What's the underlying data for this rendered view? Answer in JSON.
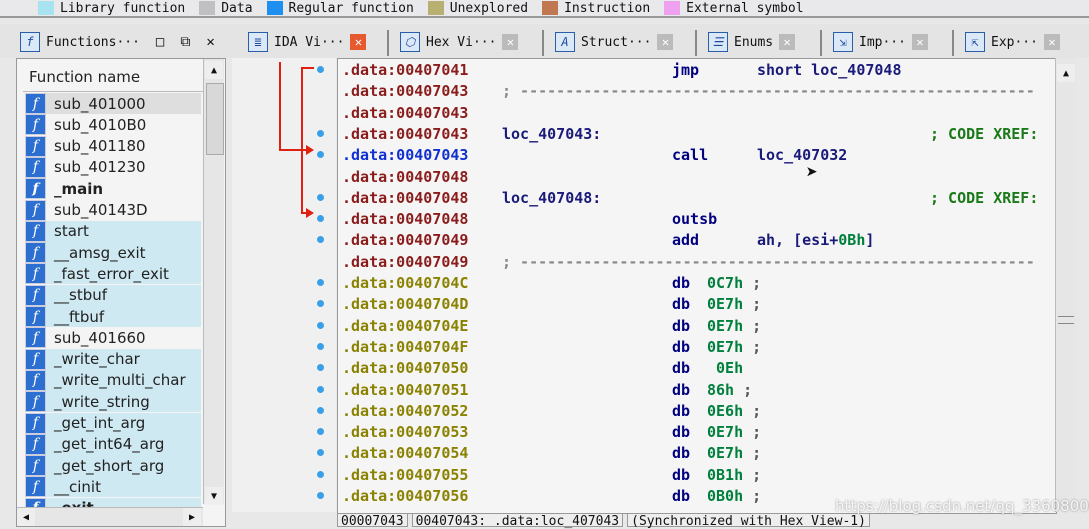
{
  "legend": [
    {
      "label": "Library function",
      "color": "#a8e4f0"
    },
    {
      "label": "Data",
      "color": "#c0c0c0"
    },
    {
      "label": "Regular function",
      "color": "#1e8ef0"
    },
    {
      "label": "Unexplored",
      "color": "#b8b070"
    },
    {
      "label": "Instruction",
      "color": "#c07850"
    },
    {
      "label": "External symbol",
      "color": "#f0a0f0"
    }
  ],
  "tabs": [
    {
      "label": "Functions···",
      "icon": "function-icon"
    },
    {
      "label": "IDA Vi···",
      "icon": "ida-view-icon",
      "active": true
    },
    {
      "label": "Hex Vi···",
      "icon": "hex-view-icon"
    },
    {
      "label": "Struct···",
      "icon": "structures-icon"
    },
    {
      "label": "Enums",
      "icon": "enums-icon"
    },
    {
      "label": "Imp···",
      "icon": "imports-icon"
    },
    {
      "label": "Exp···",
      "icon": "exports-icon"
    }
  ],
  "functions": {
    "header": "Function name",
    "items": [
      {
        "name": "sub_401000",
        "kind": "regular",
        "selected": true
      },
      {
        "name": "sub_4010B0",
        "kind": "regular"
      },
      {
        "name": "sub_401180",
        "kind": "regular"
      },
      {
        "name": "sub_401230",
        "kind": "regular"
      },
      {
        "name": "_main",
        "kind": "regular",
        "bold": true
      },
      {
        "name": "sub_40143D",
        "kind": "regular"
      },
      {
        "name": "start",
        "kind": "library"
      },
      {
        "name": "__amsg_exit",
        "kind": "library"
      },
      {
        "name": "_fast_error_exit",
        "kind": "library"
      },
      {
        "name": "__stbuf",
        "kind": "library"
      },
      {
        "name": "__ftbuf",
        "kind": "library"
      },
      {
        "name": "sub_401660",
        "kind": "regular"
      },
      {
        "name": "_write_char",
        "kind": "library"
      },
      {
        "name": "_write_multi_char",
        "kind": "library"
      },
      {
        "name": "_write_string",
        "kind": "library"
      },
      {
        "name": "_get_int_arg",
        "kind": "library"
      },
      {
        "name": "_get_int64_arg",
        "kind": "library"
      },
      {
        "name": "_get_short_arg",
        "kind": "library"
      },
      {
        "name": "__cinit",
        "kind": "library"
      },
      {
        "name": "_exit",
        "kind": "library",
        "bold": true
      }
    ]
  },
  "code": [
    {
      "addr": ".data:00407041",
      "mn": "jmp",
      "op": "short loc_407048",
      "style": "explored"
    },
    {
      "addr": ".data:00407043",
      "sep": true,
      "style": "explored"
    },
    {
      "addr": ".data:00407043",
      "style": "explored"
    },
    {
      "addr": ".data:00407043",
      "label": "loc_407043:",
      "comment": "; CODE XREF:",
      "style": "explored"
    },
    {
      "addr": ".data:00407043",
      "mn": "call",
      "op": "loc_407032",
      "style": "current"
    },
    {
      "addr": ".data:00407048",
      "style": "explored"
    },
    {
      "addr": ".data:00407048",
      "label": "loc_407048:",
      "comment": "; CODE XREF:",
      "style": "explored"
    },
    {
      "addr": ".data:00407048",
      "mn": "outsb",
      "style": "explored"
    },
    {
      "addr": ".data:00407049",
      "mn": "add",
      "op": "ah, [esi+",
      "num": "0Bh",
      "op2": "]",
      "style": "explored"
    },
    {
      "addr": ".data:00407049",
      "sep": true,
      "style": "explored"
    },
    {
      "addr": ".data:0040704C",
      "mn": "db",
      "num": "0C7h",
      "semi": ";",
      "style": "unexplored"
    },
    {
      "addr": ".data:0040704D",
      "mn": "db",
      "num": "0E7h",
      "semi": ";",
      "style": "unexplored"
    },
    {
      "addr": ".data:0040704E",
      "mn": "db",
      "num": "0E7h",
      "semi": ";",
      "style": "unexplored"
    },
    {
      "addr": ".data:0040704F",
      "mn": "db",
      "num": "0E7h",
      "semi": ";",
      "style": "unexplored"
    },
    {
      "addr": ".data:00407050",
      "mn": "db",
      "num": " 0Eh",
      "style": "unexplored"
    },
    {
      "addr": ".data:00407051",
      "mn": "db",
      "num": "86h",
      "semi": ";",
      "style": "unexplored"
    },
    {
      "addr": ".data:00407052",
      "mn": "db",
      "num": "0E6h",
      "semi": ";",
      "style": "unexplored"
    },
    {
      "addr": ".data:00407053",
      "mn": "db",
      "num": "0E7h",
      "semi": ";",
      "style": "unexplored"
    },
    {
      "addr": ".data:00407054",
      "mn": "db",
      "num": "0E7h",
      "semi": ";",
      "style": "unexplored"
    },
    {
      "addr": ".data:00407055",
      "mn": "db",
      "num": "0B1h",
      "semi": ";",
      "style": "unexplored"
    },
    {
      "addr": ".data:00407056",
      "mn": "db",
      "num": "0B0h",
      "semi": ";",
      "style": "unexplored"
    }
  ],
  "separator": "; ---------------------------------------------------------",
  "status": [
    "00007043",
    "00407043: .data:loc_407043",
    "(Synchronized with Hex View-1)"
  ],
  "watermark": "https://blog.csdn.net/qq_33608000"
}
